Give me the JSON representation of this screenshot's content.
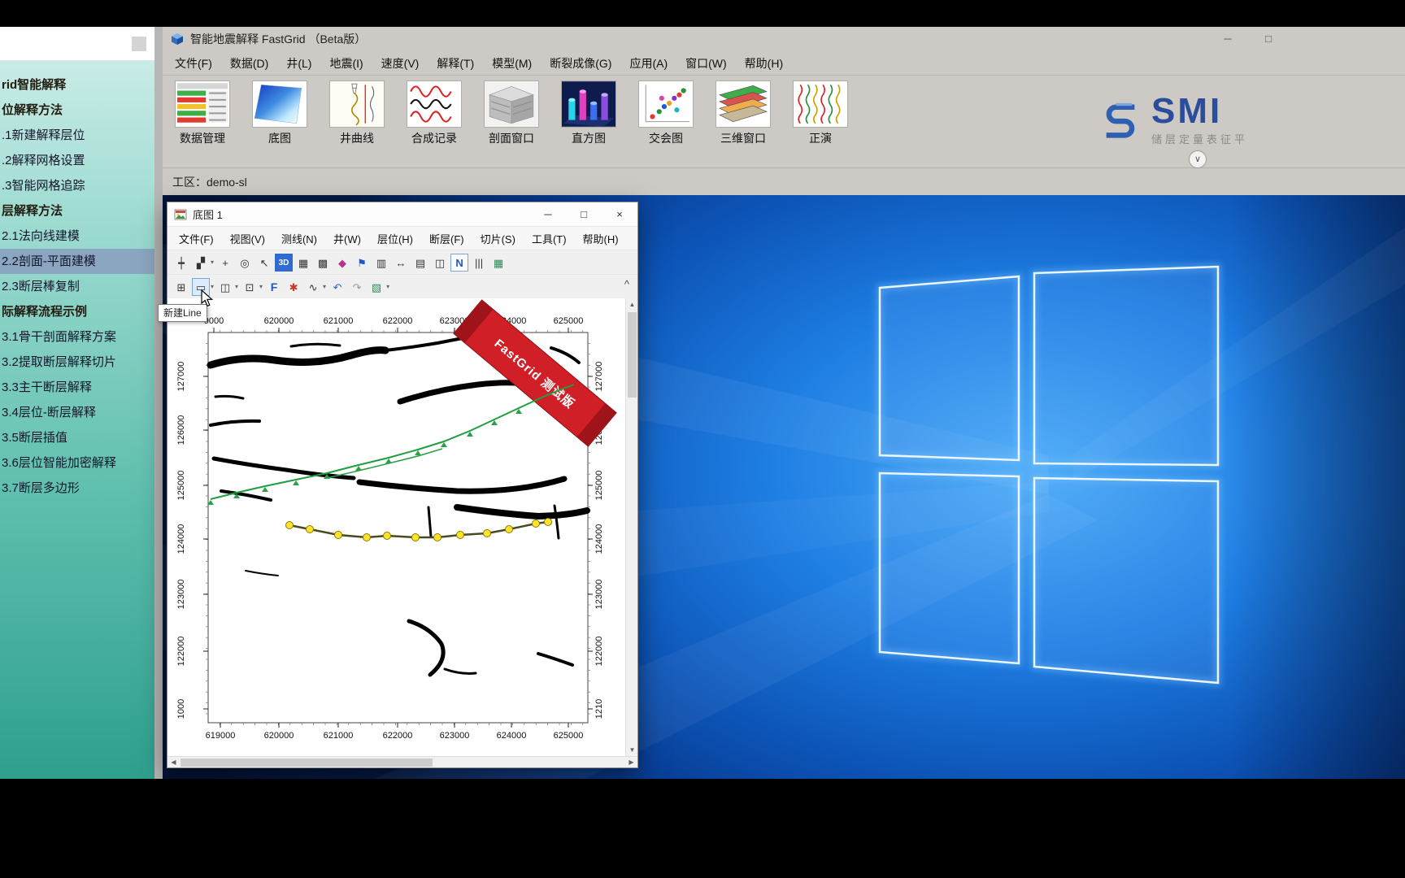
{
  "icons": {
    "up": "▲",
    "down": "▼",
    "left": "◀",
    "right": "▶"
  },
  "sidebar": {
    "items": [
      {
        "label": "rid智能解释",
        "bold": true
      },
      {
        "label": "位解释方法",
        "bold": true
      },
      {
        "label": ".1新建解释层位"
      },
      {
        "label": ".2解释网格设置"
      },
      {
        "label": ".3智能网格追踪"
      },
      {
        "label": "层解释方法",
        "bold": true
      },
      {
        "label": "2.1法向线建模"
      },
      {
        "label": "2.2剖面-平面建模",
        "active": true
      },
      {
        "label": "2.3断层棒复制"
      },
      {
        "label": "际解释流程示例",
        "bold": true
      },
      {
        "label": "3.1骨干剖面解释方案"
      },
      {
        "label": "3.2提取断层解释切片"
      },
      {
        "label": "3.3主干断层解释"
      },
      {
        "label": "3.4层位-断层解释"
      },
      {
        "label": "3.5断层插值"
      },
      {
        "label": "3.6层位智能加密解释"
      },
      {
        "label": "3.7断层多边形"
      }
    ]
  },
  "main_window": {
    "title": "智能地震解释 FastGrid （Beta版）",
    "window_controls": {
      "minimize": "─",
      "maximize": "□"
    },
    "menus": [
      "文件(F)",
      "数据(D)",
      "井(L)",
      "地震(I)",
      "速度(V)",
      "解释(T)",
      "模型(M)",
      "断裂成像(G)",
      "应用(A)",
      "窗口(W)",
      "帮助(H)"
    ],
    "toolbar": [
      {
        "name": "data-manager",
        "label": "数据管理"
      },
      {
        "name": "base-map",
        "label": "底图"
      },
      {
        "name": "well-curve",
        "label": "井曲线"
      },
      {
        "name": "synthetic-record",
        "label": "合成记录"
      },
      {
        "name": "section-window",
        "label": "剖面窗口"
      },
      {
        "name": "histogram",
        "label": "直方图"
      },
      {
        "name": "cross-plot",
        "label": "交会图"
      },
      {
        "name": "three-d-window",
        "label": "三维窗口"
      },
      {
        "name": "forward-model",
        "label": "正演"
      }
    ],
    "workspace_label": "工区：demo-sl",
    "collapse_glyph": "∨"
  },
  "logo": {
    "text": "SMI",
    "subtext": "储层定量表征平"
  },
  "map_window": {
    "title": "底图 1",
    "controls": {
      "minimize": "─",
      "maximize": "□",
      "close": "×"
    },
    "menus": [
      "文件(F)",
      "视图(V)",
      "测线(N)",
      "井(W)",
      "层位(H)",
      "断层(F)",
      "切片(S)",
      "工具(T)",
      "帮助(H)"
    ],
    "toolbar_row1": [
      {
        "name": "track-lines-icon",
        "glyph": "┿"
      },
      {
        "name": "copy-line-icon",
        "glyph": "▞",
        "caret": true
      },
      {
        "name": "pan-icon",
        "glyph": "+"
      },
      {
        "name": "zoom-window-icon",
        "glyph": "◎"
      },
      {
        "name": "pointer-icon",
        "glyph": "↖"
      },
      {
        "name": "view-3d-button",
        "glyph": "3D",
        "style": "btn3d"
      },
      {
        "name": "grid-data-icon",
        "glyph": "▦"
      },
      {
        "name": "grid-edit-icon",
        "glyph": "▩"
      },
      {
        "name": "color-diamond-icon",
        "glyph": "◆",
        "color": "#b5338a"
      },
      {
        "name": "flag-icon",
        "glyph": "⚑",
        "color": "#1f59c4"
      },
      {
        "name": "bar-columns-icon",
        "glyph": "▥"
      },
      {
        "name": "measure-icon",
        "glyph": "↔"
      },
      {
        "name": "section-view-icon",
        "glyph": "▤"
      },
      {
        "name": "tile-window-icon",
        "glyph": "◫"
      },
      {
        "name": "north-button",
        "glyph": "N",
        "style": "npress"
      },
      {
        "name": "columns-icon",
        "glyph": "|||"
      },
      {
        "name": "green-grid-icon",
        "glyph": "▦",
        "color": "#2e8b57"
      }
    ],
    "toolbar_row2": [
      {
        "name": "grid-add-icon",
        "glyph": "⊞"
      },
      {
        "name": "new-line-button",
        "glyph": "▭",
        "pressed": true,
        "caret": true
      },
      {
        "name": "split-columns-icon",
        "glyph": "◫",
        "caret": true
      },
      {
        "name": "cascade-icon",
        "glyph": "⊡",
        "caret": true
      },
      {
        "name": "fault-f-button",
        "glyph": "F",
        "style": "fbtn"
      },
      {
        "name": "color-wheel-icon",
        "glyph": "✱",
        "color": "#cc3322"
      },
      {
        "name": "smooth-curve-icon",
        "glyph": "∿",
        "caret": true
      },
      {
        "name": "undo-icon",
        "glyph": "↶",
        "color": "#2a62c9"
      },
      {
        "name": "redo-icon",
        "glyph": "↷",
        "color": "#9a9a9a"
      },
      {
        "name": "paint-layers-icon",
        "glyph": "▧",
        "color": "#2e8b57",
        "caret": true
      }
    ],
    "collapse_glyph": "^",
    "tooltip": "新建Line",
    "ribbon_text": "FastGrid 测试版",
    "axes": {
      "x_top": [
        "9000",
        "620000",
        "621000",
        "622000",
        "623000",
        "624000",
        "625000"
      ],
      "x_bottom": [
        "619000",
        "620000",
        "621000",
        "622000",
        "623000",
        "624000",
        "625000"
      ],
      "y_left": [
        "127000",
        "126000",
        "125000",
        "124000",
        "123000",
        "122000",
        "1000"
      ],
      "y_right": [
        "127000",
        "126000",
        "125000",
        "124000",
        "123000",
        "122000",
        "1210"
      ]
    }
  }
}
